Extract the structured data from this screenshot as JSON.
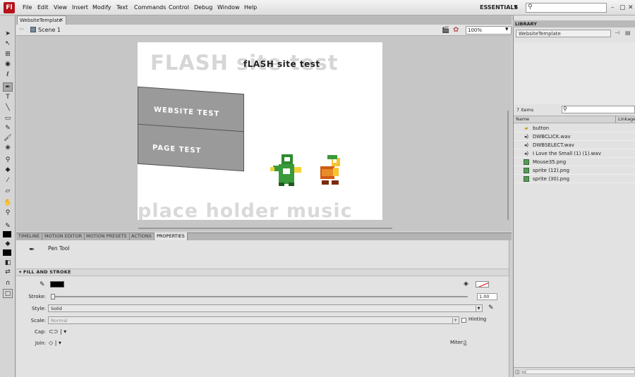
{
  "app": {
    "icon_text": "Fl",
    "workspace": "ESSENTIALS",
    "search_placeholder": ""
  },
  "menu": [
    "File",
    "Edit",
    "View",
    "Insert",
    "Modify",
    "Text",
    "Commands",
    "Control",
    "Debug",
    "Window",
    "Help"
  ],
  "document": {
    "tab": "WebsiteTemplate",
    "tab_close": "×",
    "scene": "Scene 1",
    "zoom": "100%"
  },
  "stage": {
    "title_bg": "FLASH site test",
    "title_fg": "fLASH site test",
    "button1": "WEBSITE TEST",
    "button2": "PAGE TEST",
    "footer": "place holder music"
  },
  "panel_tabs": [
    "TIMELINE",
    "MOTION EDITOR",
    "MOTION PRESETS",
    "ACTIONS",
    "PROPERTIES"
  ],
  "properties": {
    "tool_name": "Pen Tool",
    "section": "FILL AND STROKE",
    "stroke_label": "Stroke:",
    "stroke_value": "1.00",
    "style_label": "Style:",
    "style_value": "Solid",
    "scale_label": "Scale:",
    "scale_value": "Normal",
    "hinting_label": "Hinting",
    "cap_label": "Cap:",
    "join_label": "Join:",
    "miter_label": "Miter:",
    "miter_value": "3"
  },
  "library": {
    "title": "LIBRARY",
    "document": "WebsiteTemplate",
    "items_count": "7 items",
    "col_name": "Name",
    "col_linkage": "Linkage",
    "items": [
      {
        "name": "button",
        "type": "folder"
      },
      {
        "name": "DWBCLICK.wav",
        "type": "sound"
      },
      {
        "name": "DWBSELECT.wav",
        "type": "sound"
      },
      {
        "name": "I Love the Small (1) (1).wav",
        "type": "sound"
      },
      {
        "name": "Mouse35.png",
        "type": "bitmap"
      },
      {
        "name": "sprite (12).png",
        "type": "bitmap"
      },
      {
        "name": "sprite (30).png",
        "type": "bitmap"
      }
    ]
  },
  "colors": {
    "stroke": "#000000",
    "fill": "none",
    "accent": "#b5121b"
  }
}
